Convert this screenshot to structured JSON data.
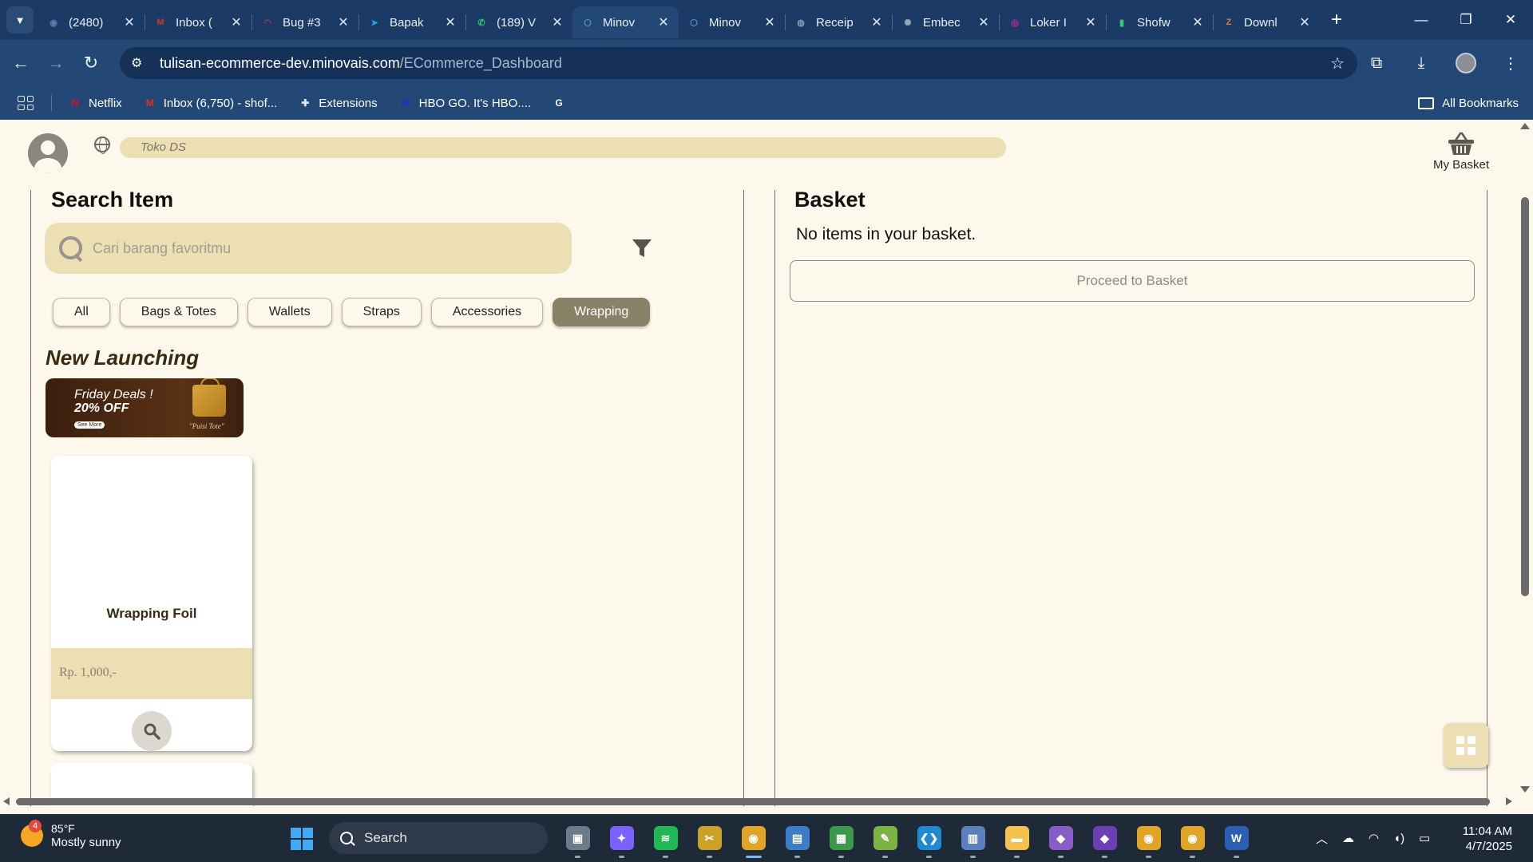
{
  "browser": {
    "tabs": [
      {
        "title": "(2480)",
        "favicon": "steam-icon",
        "color": "#5a7fb0",
        "glyph": "◉"
      },
      {
        "title": "Inbox (",
        "favicon": "gmail-icon",
        "color": "#d93025",
        "glyph": "M"
      },
      {
        "title": "Bug #3",
        "favicon": "bug-icon",
        "color": "#c0392b",
        "glyph": "◠"
      },
      {
        "title": "Bapak",
        "favicon": "telegram-icon",
        "color": "#2aa3e0",
        "glyph": "➤"
      },
      {
        "title": "(189) V",
        "favicon": "whatsapp-icon",
        "color": "#25d366",
        "glyph": "✆"
      },
      {
        "title": "Minov",
        "favicon": "minovais-icon",
        "color": "#5a8fd0",
        "glyph": "⬡",
        "active": true
      },
      {
        "title": "Minov",
        "favicon": "minovais-icon",
        "color": "#5a8fd0",
        "glyph": "⬡"
      },
      {
        "title": "Receip",
        "favicon": "globe-icon",
        "color": "#8a9bb5",
        "glyph": "◍"
      },
      {
        "title": "Embec",
        "favicon": "chatgpt-icon",
        "color": "#9aa6b6",
        "glyph": "✺"
      },
      {
        "title": "Loker I",
        "favicon": "instagram-icon",
        "color": "#d6249f",
        "glyph": "◎"
      },
      {
        "title": "Shofw",
        "favicon": "app-icon",
        "color": "#2ecc71",
        "glyph": "▮"
      },
      {
        "title": "Downl",
        "favicon": "download-site-icon",
        "color": "#e67e22",
        "glyph": "Z"
      }
    ],
    "url_domain": "tulisan-ecommerce-dev.minovais.com",
    "url_path": "/ECommerce_Dashboard",
    "bookmarks": [
      {
        "label": "Netflix",
        "favicon": "netflix-icon",
        "color": "#e50914",
        "glyph": "N"
      },
      {
        "label": "Inbox (6,750) - shof...",
        "favicon": "gmail-icon",
        "color": "#d93025",
        "glyph": "M"
      },
      {
        "label": "Extensions",
        "favicon": "puzzle-icon",
        "color": "#dfe6f2",
        "glyph": "✚"
      },
      {
        "label": "HBO GO. It's HBO....",
        "favicon": "hbo-icon",
        "color": "#1e2bd6",
        "glyph": "m"
      },
      {
        "label": "",
        "favicon": "google-icon",
        "color": "#ffffff",
        "glyph": "G"
      }
    ],
    "all_bookmarks": "All Bookmarks"
  },
  "page": {
    "store_name": "Toko DS",
    "my_basket": "My Basket",
    "search": {
      "title": "Search Item",
      "placeholder": "Cari barang favoritmu"
    },
    "categories": [
      {
        "label": "All",
        "active": false
      },
      {
        "label": "Bags & Totes",
        "active": false
      },
      {
        "label": "Wallets",
        "active": false
      },
      {
        "label": "Straps",
        "active": false
      },
      {
        "label": "Accessories",
        "active": false
      },
      {
        "label": "Wrapping",
        "active": true
      }
    ],
    "new_launching": "New Launching",
    "banner": {
      "line1": "Friday Deals !",
      "line2": "20% OFF",
      "cta": "See More",
      "product": "\"Puisi Tote\""
    },
    "products": [
      {
        "name": "Wrapping Foil",
        "price": "Rp. 1,000,-"
      }
    ],
    "basket": {
      "title": "Basket",
      "empty_text": "No items in your basket.",
      "proceed_label": "Proceed to Basket"
    }
  },
  "taskbar": {
    "weather": {
      "badge": "4",
      "temp": "85°F",
      "desc": "Mostly sunny"
    },
    "search_label": "Search",
    "apps": [
      {
        "name": "task-view-icon",
        "color": "#6c7a8c",
        "glyph": "▣"
      },
      {
        "name": "copilot-icon",
        "color": "#7b61ff",
        "glyph": "✦"
      },
      {
        "name": "spotify-icon",
        "color": "#1db954",
        "glyph": "≋"
      },
      {
        "name": "tools-icon",
        "color": "#c9a227",
        "glyph": "✂"
      },
      {
        "name": "chrome-icon",
        "color": "#e0a526",
        "glyph": "◉",
        "active": true
      },
      {
        "name": "remote-desktop-icon",
        "color": "#3d7cc9",
        "glyph": "▤"
      },
      {
        "name": "sheets-icon",
        "color": "#3a9a4a",
        "glyph": "▦"
      },
      {
        "name": "snipping-icon",
        "color": "#7cb342",
        "glyph": "✎"
      },
      {
        "name": "vscode-icon",
        "color": "#1f8ad2",
        "glyph": "❮❯"
      },
      {
        "name": "notes-icon",
        "color": "#5b7fbf",
        "glyph": "▥"
      },
      {
        "name": "file-explorer-icon",
        "color": "#f2c14e",
        "glyph": "▬"
      },
      {
        "name": "visual-studio-icon",
        "color": "#8a5cc9",
        "glyph": "◆"
      },
      {
        "name": "visual-studio-2-icon",
        "color": "#6c3fb5",
        "glyph": "◆"
      },
      {
        "name": "chrome-2-icon",
        "color": "#e0a526",
        "glyph": "◉"
      },
      {
        "name": "chrome-3-icon",
        "color": "#e0a526",
        "glyph": "◉"
      },
      {
        "name": "word-icon",
        "color": "#2b5fb4",
        "glyph": "W"
      }
    ],
    "clock_time": "11:04 AM",
    "clock_date": "4/7/2025"
  }
}
